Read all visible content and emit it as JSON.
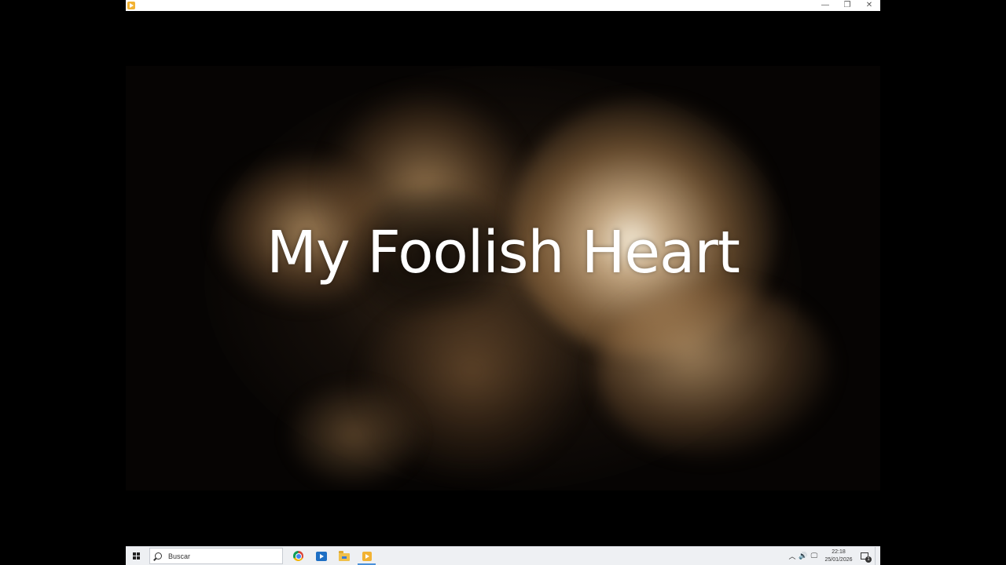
{
  "window": {
    "controls": {
      "minimize": "—",
      "restore": "❐",
      "close": "✕"
    }
  },
  "video": {
    "title": "My Foolish Heart"
  },
  "taskbar": {
    "search_placeholder": "Buscar",
    "apps": [
      {
        "name": "chrome",
        "icon": "chrome-icon"
      },
      {
        "name": "media",
        "icon": "media-player-icon"
      },
      {
        "name": "file-explorer",
        "icon": "folder-icon"
      },
      {
        "name": "video-player",
        "icon": "player-icon"
      }
    ],
    "tray": {
      "chevron": "︿",
      "volume": "🔊",
      "network": "🖵",
      "time": "22:18",
      "date": "25/01/2026",
      "notification_count": "1"
    }
  },
  "colors": {
    "accent": "#4a90d9",
    "player_icon": "#f2b233",
    "sepia_light": "#e8c69a"
  }
}
